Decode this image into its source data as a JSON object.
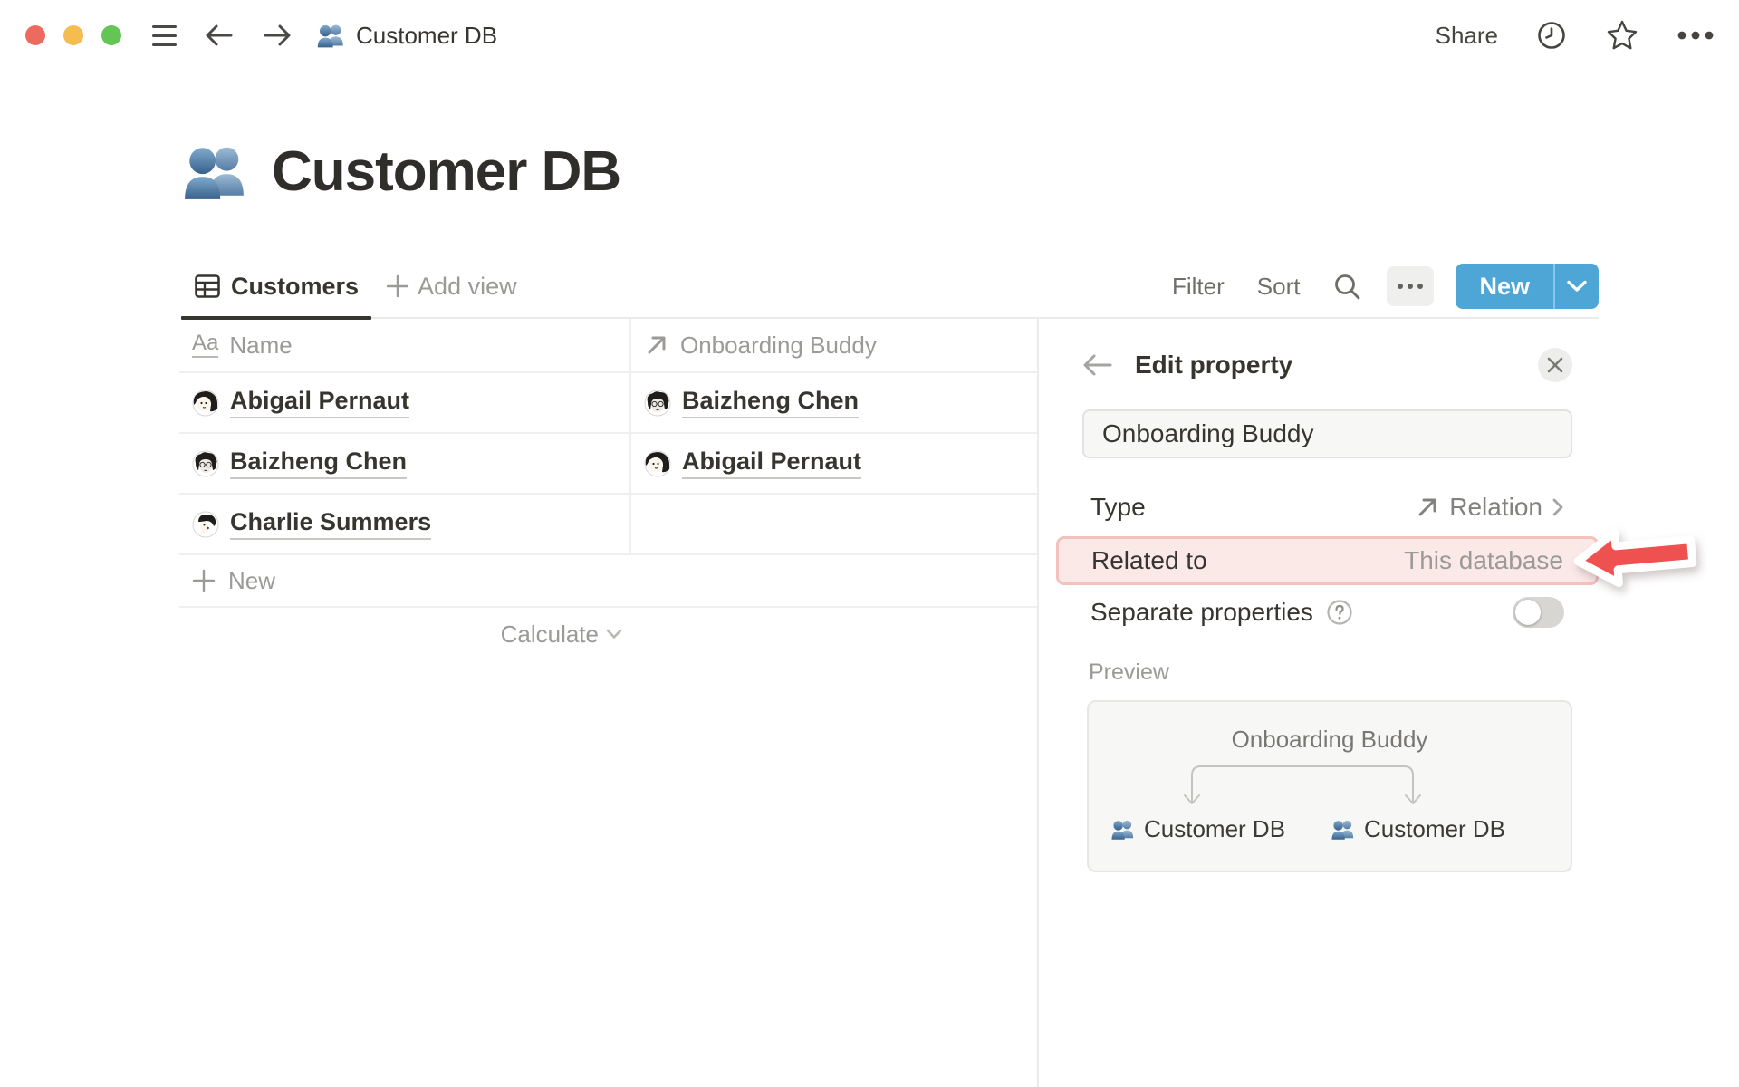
{
  "topbar": {
    "doc_title": "Customer DB",
    "share_label": "Share"
  },
  "page": {
    "title": "Customer DB"
  },
  "views": {
    "active_tab": "Customers",
    "add_view_label": "Add view",
    "filter_label": "Filter",
    "sort_label": "Sort",
    "new_button_label": "New"
  },
  "table": {
    "columns": [
      {
        "label": "Name",
        "type": "title"
      },
      {
        "label": "Onboarding Buddy",
        "type": "relation"
      }
    ],
    "rows": [
      {
        "name": "Abigail Pernaut",
        "name_avatar": "abigail",
        "buddy": "Baizheng Chen",
        "buddy_avatar": "baizheng"
      },
      {
        "name": "Baizheng Chen",
        "name_avatar": "baizheng",
        "buddy": "Abigail Pernaut",
        "buddy_avatar": "abigail"
      },
      {
        "name": "Charlie Summers",
        "name_avatar": "charlie",
        "buddy": ""
      }
    ],
    "new_row_label": "New",
    "calculate_label": "Calculate"
  },
  "panel": {
    "title": "Edit property",
    "name_input_value": "Onboarding Buddy",
    "type_row": {
      "label": "Type",
      "value": "Relation"
    },
    "related_row": {
      "label": "Related to",
      "value": "This database"
    },
    "separate_row": {
      "label": "Separate properties",
      "toggle_state": "off"
    },
    "preview": {
      "label": "Preview",
      "relation_name": "Onboarding Buddy",
      "left_db": "Customer DB",
      "right_db": "Customer DB"
    }
  },
  "icons": {
    "people-icon": "two blue busts (database emoji)",
    "clock-icon": "history / updates",
    "star-icon": "favorite",
    "more-icon": "ellipsis menu",
    "table-view-icon": "table view",
    "relation-icon": "diagonal arrow",
    "text-type-icon": "Aa",
    "search-icon": "magnifier",
    "help-icon": "question mark circle",
    "annotation-arrow": "red arrow pointing at Related to row"
  },
  "colors": {
    "accent_blue": "#4DA6D6",
    "highlight_bg": "#FBE9E8",
    "highlight_border": "#F3C1BE",
    "annotation_red": "#EE514F",
    "traffic_red": "#ED6A5F",
    "traffic_yellow": "#F5BD4F",
    "traffic_green": "#62C554"
  }
}
